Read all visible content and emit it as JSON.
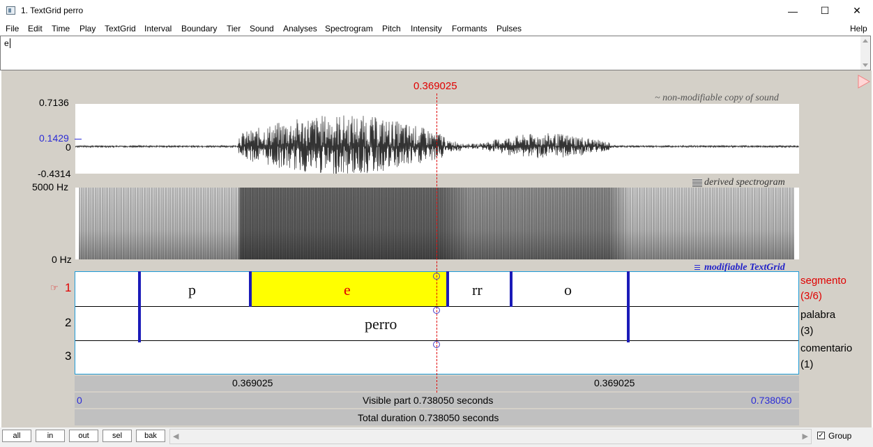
{
  "window": {
    "title": "1. TextGrid perro",
    "minimize_glyph": "—",
    "maximize_glyph": "☐",
    "close_glyph": "✕"
  },
  "menu": {
    "items": [
      "File",
      "Edit",
      "Time",
      "Play",
      "TextGrid",
      "Interval",
      "Boundary",
      "Tier",
      "Sound",
      "Analyses",
      "Spectrogram",
      "Pitch",
      "Intensity",
      "Formants",
      "Pulses"
    ],
    "help": "Help"
  },
  "text_field": {
    "value": "e"
  },
  "cursor": {
    "time_label": "0.369025"
  },
  "sound": {
    "caption": "~ non-modifiable copy of sound",
    "y_max": "0.7136",
    "y_cursor": "0.1429",
    "y_zero": "0",
    "y_min": "-0.4314"
  },
  "spectrogram": {
    "caption": "derived spectrogram",
    "icon": "spectrogram-icon",
    "y_max": "5000 Hz",
    "y_min": "0 Hz"
  },
  "textgrid": {
    "caption": "modifiable TextGrid",
    "icon": "textgrid-icon",
    "tiers": [
      {
        "number": "1",
        "name": "segmento",
        "count": "(3/6)",
        "selected": true,
        "intervals": [
          "p",
          "e",
          "rr",
          "o"
        ]
      },
      {
        "number": "2",
        "name": "palabra",
        "count": "(3)",
        "selected": false,
        "intervals": [
          "perro"
        ]
      },
      {
        "number": "3",
        "name": "comentario",
        "count": "(1)",
        "selected": false,
        "intervals": []
      }
    ]
  },
  "time_bars": {
    "left_segment": "0.369025",
    "right_segment": "0.369025",
    "visible_start": "0",
    "visible_label": "Visible part 0.738050 seconds",
    "visible_end": "0.738050",
    "total_label": "Total duration 0.738050 seconds"
  },
  "toolbar": {
    "buttons": [
      "all",
      "in",
      "out",
      "sel",
      "bak"
    ],
    "group_label": "Group",
    "group_checked": true
  },
  "colors": {
    "cursor": "#e00000",
    "boundary": "#1b1bb8",
    "selected_interval": "#ffff00",
    "accent_blue": "#2b2bd6",
    "frame": "#1e9bd7",
    "background": "#d4d0c8"
  }
}
